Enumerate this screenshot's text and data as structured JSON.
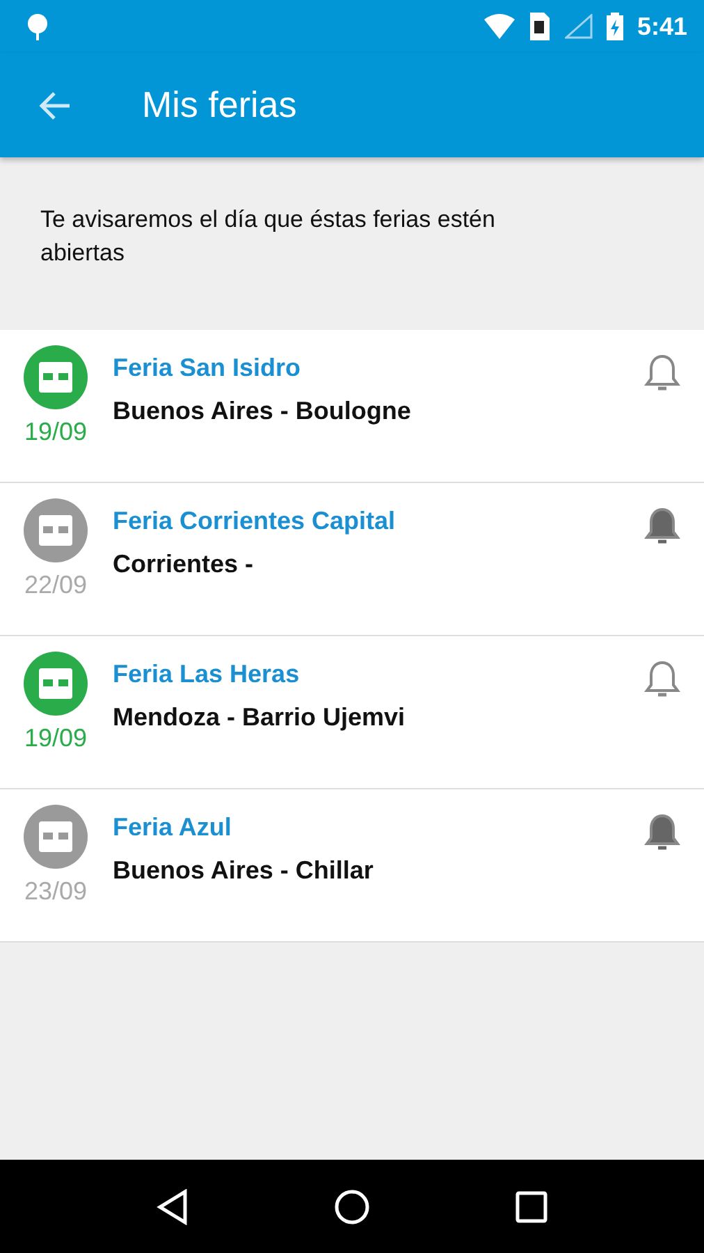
{
  "status_bar": {
    "time": "5:41"
  },
  "app_bar": {
    "title": "Mis ferias"
  },
  "notice": "Te avisaremos el día que éstas ferias estén abiertas",
  "fairs": [
    {
      "name": "Feria San Isidro",
      "location": "Buenos Aires - Boulogne",
      "date": "19/09",
      "open": true,
      "alert_on": false
    },
    {
      "name": "Feria Corrientes Capital",
      "location": "Corrientes -",
      "date": "22/09",
      "open": false,
      "alert_on": true
    },
    {
      "name": "Feria Las Heras",
      "location": "Mendoza - Barrio Ujemvi",
      "date": "19/09",
      "open": true,
      "alert_on": false
    },
    {
      "name": "Feria Azul",
      "location": "Buenos Aires - Chillar",
      "date": "23/09",
      "open": false,
      "alert_on": true
    }
  ]
}
